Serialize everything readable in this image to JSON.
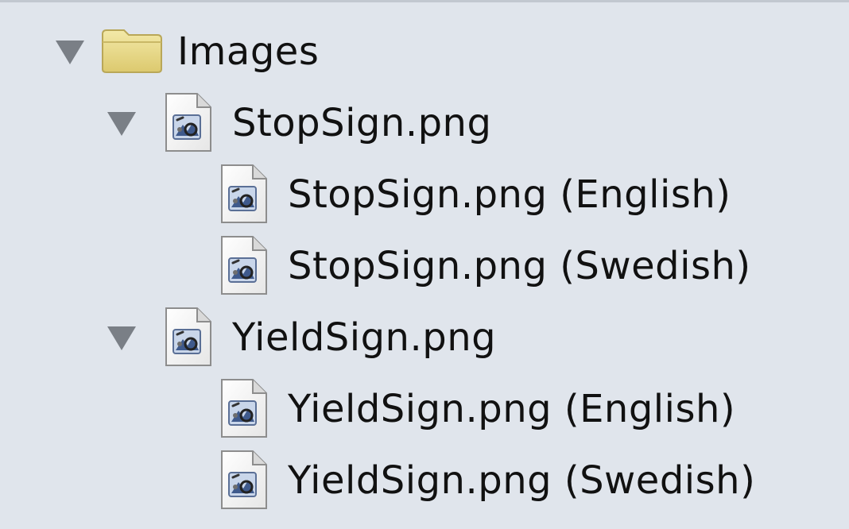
{
  "tree": {
    "root": {
      "label": "Images",
      "icon": "folder-icon",
      "expanded": true,
      "children": [
        {
          "label": "StopSign.png",
          "icon": "image-file-icon",
          "expanded": true,
          "children": [
            {
              "label": "StopSign.png (English)",
              "icon": "image-file-icon"
            },
            {
              "label": "StopSign.png (Swedish)",
              "icon": "image-file-icon"
            }
          ]
        },
        {
          "label": "YieldSign.png",
          "icon": "image-file-icon",
          "expanded": true,
          "children": [
            {
              "label": "YieldSign.png (English)",
              "icon": "image-file-icon"
            },
            {
              "label": "YieldSign.png (Swedish)",
              "icon": "image-file-icon"
            }
          ]
        }
      ]
    }
  },
  "colors": {
    "background": "#e0e5ec",
    "disclosure": "#7a7f86",
    "folder": "#e8d98a",
    "text": "#111111"
  }
}
